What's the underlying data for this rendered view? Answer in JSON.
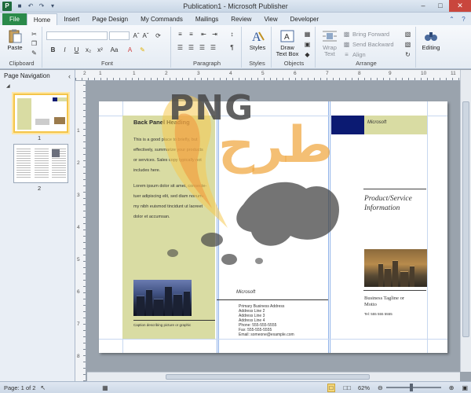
{
  "window": {
    "title": "Publication1 - Microsoft Publisher"
  },
  "tabs": {
    "file": "File",
    "items": [
      "Home",
      "Insert",
      "Page Design",
      "My Commands",
      "Mailings",
      "Review",
      "View",
      "Developer"
    ]
  },
  "ribbon": {
    "clipboard": {
      "paste": "Paste",
      "label": "Clipboard"
    },
    "font": {
      "label": "Font",
      "buttons": [
        "B",
        "I",
        "U",
        "x₂",
        "x²",
        "Aa"
      ]
    },
    "paragraph": {
      "label": "Paragraph"
    },
    "styles": {
      "button": "Styles",
      "label": "Styles"
    },
    "objects": {
      "draw_text_box_line1": "Draw",
      "draw_text_box_line2": "Text Box",
      "label": "Objects"
    },
    "arrange": {
      "wrap_text_line1": "Wrap",
      "wrap_text_line2": "Text",
      "bring_forward": "Bring Forward",
      "send_backward": "Send Backward",
      "align": "Align",
      "label": "Arrange"
    },
    "editing": {
      "button": "Editing"
    }
  },
  "navigation": {
    "title": "Page Navigation",
    "pages": [
      "1",
      "2"
    ]
  },
  "ruler": {
    "h_numbers": [
      "2",
      "1",
      "1",
      "2",
      "3",
      "4",
      "5",
      "6",
      "7",
      "8",
      "9",
      "10",
      "11"
    ],
    "v_numbers": [
      "1",
      "2",
      "3",
      "4",
      "5",
      "6",
      "7",
      "8"
    ]
  },
  "publication": {
    "back_panel_heading": "Back Panel Heading",
    "back_panel_body": [
      "This is a good place to briefly, but",
      "effectively, summarize your products",
      "or services. Sales copy typically not",
      "includes here.",
      "Lorem ipsum dolor sit amet, consecte-",
      "tuer adipiscing elit, sed diam nonum-",
      "my nibh euismod tincidunt ut laoreet",
      "dolor et accumsan."
    ],
    "caption": "Caption describing picture or graphic",
    "logo_text": "Microsoft",
    "address_lines": [
      "Primary Business Address",
      "Address Line 2",
      "Address Line 3",
      "Address Line 4",
      "Phone: 555-555-5555",
      "Fax: 555-555-5555",
      "Email: someone@example.com"
    ],
    "product_title_line1": "Product/Service",
    "product_title_line2": "Information",
    "tagline_line1": "Business Tagline or",
    "tagline_line2": "Motto",
    "tel": "Tel: 555 555 5555"
  },
  "watermark": {
    "latin": "PNG",
    "arabic": "طرح"
  },
  "status": {
    "page": "Page: 1 of 2",
    "zoom": "62%"
  },
  "colors": {
    "accent_green": "#2a8a4a",
    "panel_olive": "#d9dca3",
    "navy": "#0b1a72",
    "watermark_orange": "#f0aa46"
  }
}
